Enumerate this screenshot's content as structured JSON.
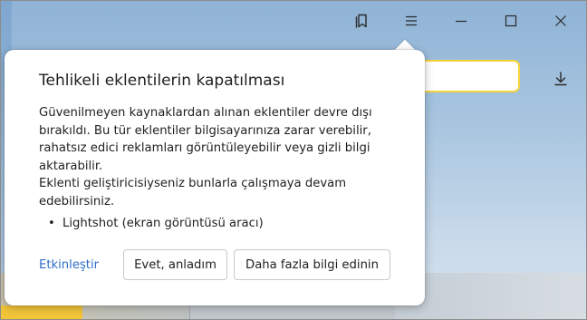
{
  "titlebar": {
    "icons": [
      "bookmarks-icon",
      "menu-icon",
      "minimize-icon",
      "maximize-icon",
      "close-icon"
    ]
  },
  "toolbar": {
    "download_icon": "download-icon",
    "address_accent": "#f6d33c"
  },
  "dialog": {
    "title": "Tehlikeli eklentilerin kapatılması",
    "body_lines": [
      "Güvenilmeyen kaynaklardan alınan eklentiler devre dışı",
      "bırakıldı. Bu tür eklentiler bilgisayarınıza zarar verebilir,",
      "rahatsız edici reklamları görüntüleyebilir veya gizli bilgi",
      "aktarabilir.",
      "Eklenti geliştiricisiyseniz bunlarla çalışmaya devam",
      "edebilirsiniz."
    ],
    "extensions": [
      "Lightshot (ekran görüntüsü aracı)"
    ],
    "enable_link": "Etkinleştir",
    "ok_button": "Evet, anladım",
    "more_button": "Daha fazla bilgi edinin",
    "link_color": "#2d6ec9"
  }
}
